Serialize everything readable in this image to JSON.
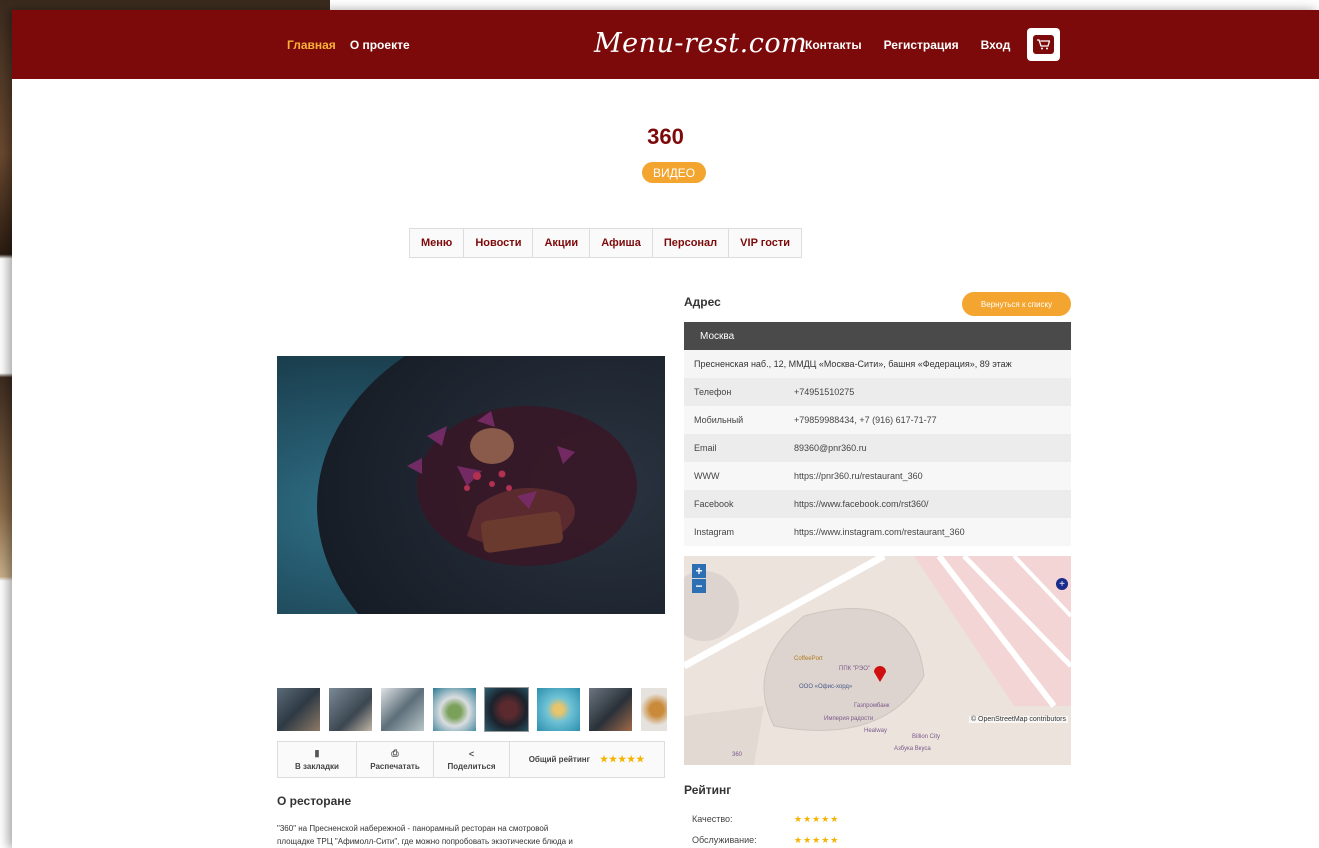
{
  "nav": {
    "left": [
      "Главная",
      "О проекте"
    ],
    "logo": "Menu-rest.com",
    "right": [
      "Контакты",
      "Регистрация",
      "Вход"
    ]
  },
  "restaurant": {
    "name": "360",
    "video_label": "ВИДЕО"
  },
  "tabs": [
    "Меню",
    "Новости",
    "Акции",
    "Афиша",
    "Персонал",
    "VIP гости"
  ],
  "actions": {
    "bookmark": "В закладки",
    "print": "Распечатать",
    "share": "Поделиться",
    "rating_label": "Общий рейтинг",
    "rating_stars": "★★★★★"
  },
  "about": {
    "title": "О ресторане",
    "text_line1": "\"360\" на Пресненской набережной - панорамный ресторан на смотровой",
    "text_line2": "площадке ТРЦ \"Афимолл-Сити\", где можно попробовать экзотические блюда и"
  },
  "address": {
    "title": "Адрес",
    "back_button": "Вернуться к списку",
    "city": "Москва",
    "full": "Пресненская наб., 12, ММДЦ «Москва-Сити», башня «Федерация», 89 этаж",
    "rows": [
      {
        "label": "Телефон",
        "value": "+74951510275"
      },
      {
        "label": "Мобильный",
        "value": "+79859988434, +7 (916) 617-71-77"
      },
      {
        "label": "Email",
        "value": "89360@pnr360.ru"
      },
      {
        "label": "WWW",
        "value": "https://pnr360.ru/restaurant_360"
      },
      {
        "label": "Facebook",
        "value": "https://www.facebook.com/rst360/"
      },
      {
        "label": "Instagram",
        "value": "https://www.instagram.com/restaurant_360"
      }
    ]
  },
  "map": {
    "zoom_in": "+",
    "zoom_out": "−",
    "attribution": "© OpenStreetMap contributors",
    "labels": [
      "CoffeePort",
      "ППК \"РЭО\"",
      "ООО «Офис-хорд»",
      "Газпромбанк",
      "Империя радости",
      "Healway",
      "Азбука Вкуса",
      "Billion City",
      "360"
    ]
  },
  "rating": {
    "title": "Рейтинг",
    "rows": [
      {
        "label": "Качество:",
        "stars": "★★★★★"
      },
      {
        "label": "Обслуживание:",
        "stars": "★★★★★"
      }
    ]
  },
  "colors": {
    "brand": "#7d0a0a",
    "accent": "#f4a52f",
    "active_nav": "#f7b23b",
    "star": "#f4b400"
  }
}
